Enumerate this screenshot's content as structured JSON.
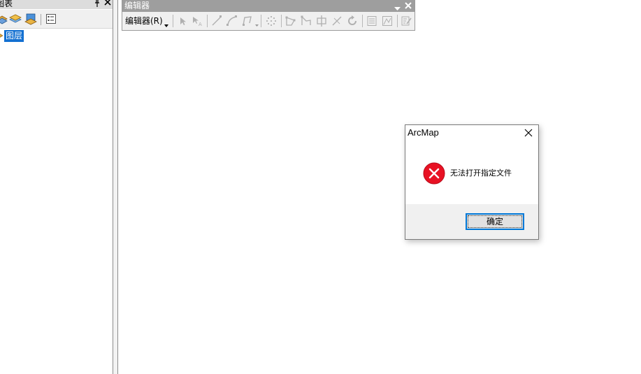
{
  "toc": {
    "title": "图表",
    "layers_label": "图层",
    "icons": [
      "list-by-drawing-order-icon",
      "list-by-source-icon",
      "list-by-visibility-icon",
      "list-by-selection-icon",
      "options-icon"
    ]
  },
  "editor_toolbar": {
    "title": "编辑器",
    "menu_label": "编辑器(R)",
    "tools": [
      "edit-tool-icon",
      "edit-annotation-tool-icon",
      "straight-segment-icon",
      "end-point-arc-icon",
      "trace-icon",
      "point-icon",
      "edit-vertices-icon",
      "reshape-feature-icon",
      "cut-polygons-icon",
      "split-tool-icon",
      "rotate-tool-icon",
      "attributes-icon",
      "sketch-properties-icon",
      "create-features-icon"
    ]
  },
  "dialog": {
    "title": "ArcMap",
    "message": "无法打开指定文件",
    "ok_label": "确定",
    "icon": "error-icon"
  },
  "colors": {
    "selection": "#1370d1",
    "error_red": "#e81123",
    "focus_blue": "#0078d7",
    "toolbar_title_bg": "#9e9e9e"
  }
}
